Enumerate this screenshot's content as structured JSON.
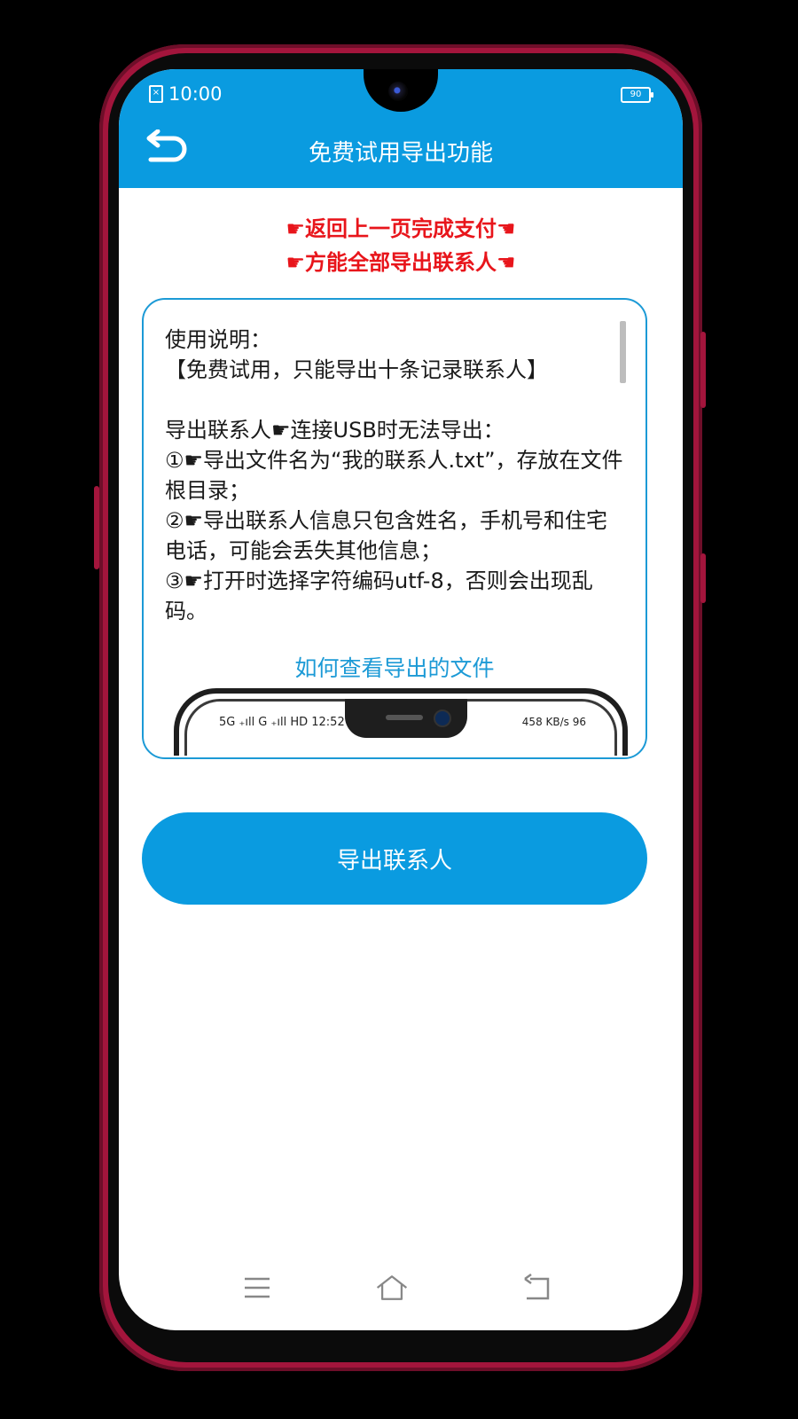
{
  "status_bar": {
    "time": "10:00",
    "battery": "90"
  },
  "header": {
    "title": "免费试用导出功能",
    "back_icon": "back-arrow-icon"
  },
  "notices": [
    {
      "text": "返回上一页完成支付"
    },
    {
      "text": "方能全部导出联系人"
    }
  ],
  "instructions": {
    "text": "使用说明：\n【免费试用，只能导出十条记录联系人】\n\n导出联系人☛连接USB时无法导出：\n①☛导出文件名为“我的联系人.txt”，存放在文件根目录；\n②☛导出联系人信息只包含姓名，手机号和住宅电话，可能会丢失其他信息；\n③☛打开时选择字符编码utf-8，否则会出现乱码。",
    "help_link": "如何查看导出的文件",
    "mini_phone": {
      "status_left": "5G ₊ıll G ₊ıll HD 12:52 %",
      "status_right": "458 KB/s  96"
    }
  },
  "export_button": {
    "label": "导出联系人"
  },
  "nav": {
    "menu_icon": "menu-icon",
    "home_icon": "home-icon",
    "back_icon": "back-icon"
  },
  "colors": {
    "accent": "#0a9be0",
    "notice": "#e8151b",
    "frame": "#a3153c"
  }
}
